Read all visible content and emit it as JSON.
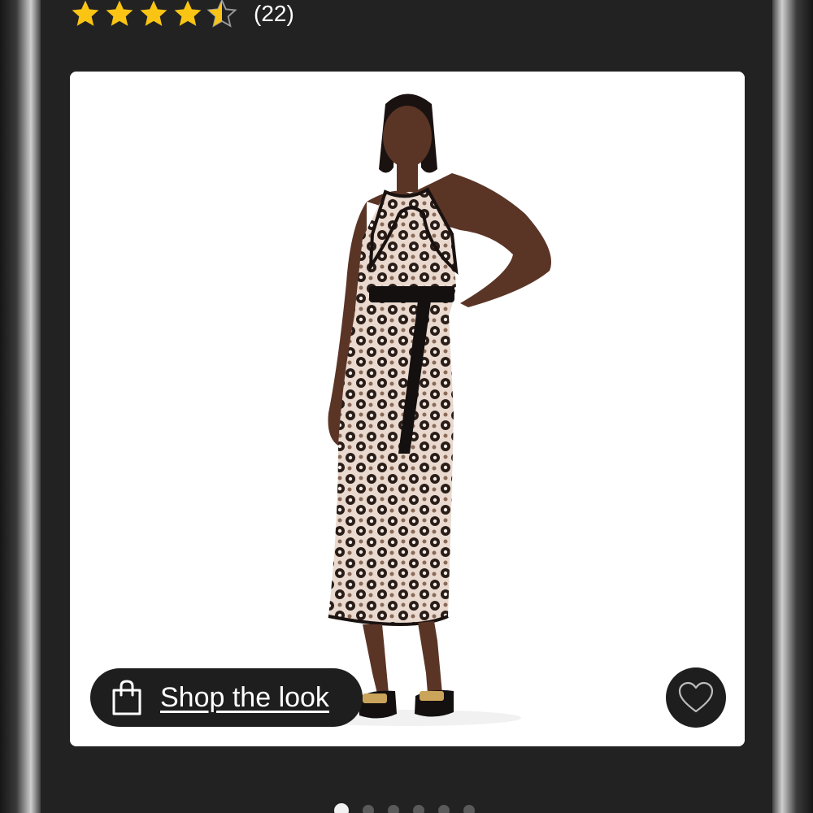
{
  "rating": {
    "value": 4.5,
    "max": 5,
    "review_count": "(22)",
    "star_color": "#F9C414"
  },
  "hero": {
    "alt": "Model wearing a sleeveless halter-neck floral knit midi dress with black tie belt and black sandals",
    "shop_label": "Shop the look",
    "shop_icon": "shopping-bag-icon",
    "favorite_icon": "heart-icon"
  },
  "carousel": {
    "total": 6,
    "active_index": 0
  },
  "colors": {
    "background": "#222222",
    "card": "#FFFFFF",
    "pill": "#1E1E1E"
  }
}
